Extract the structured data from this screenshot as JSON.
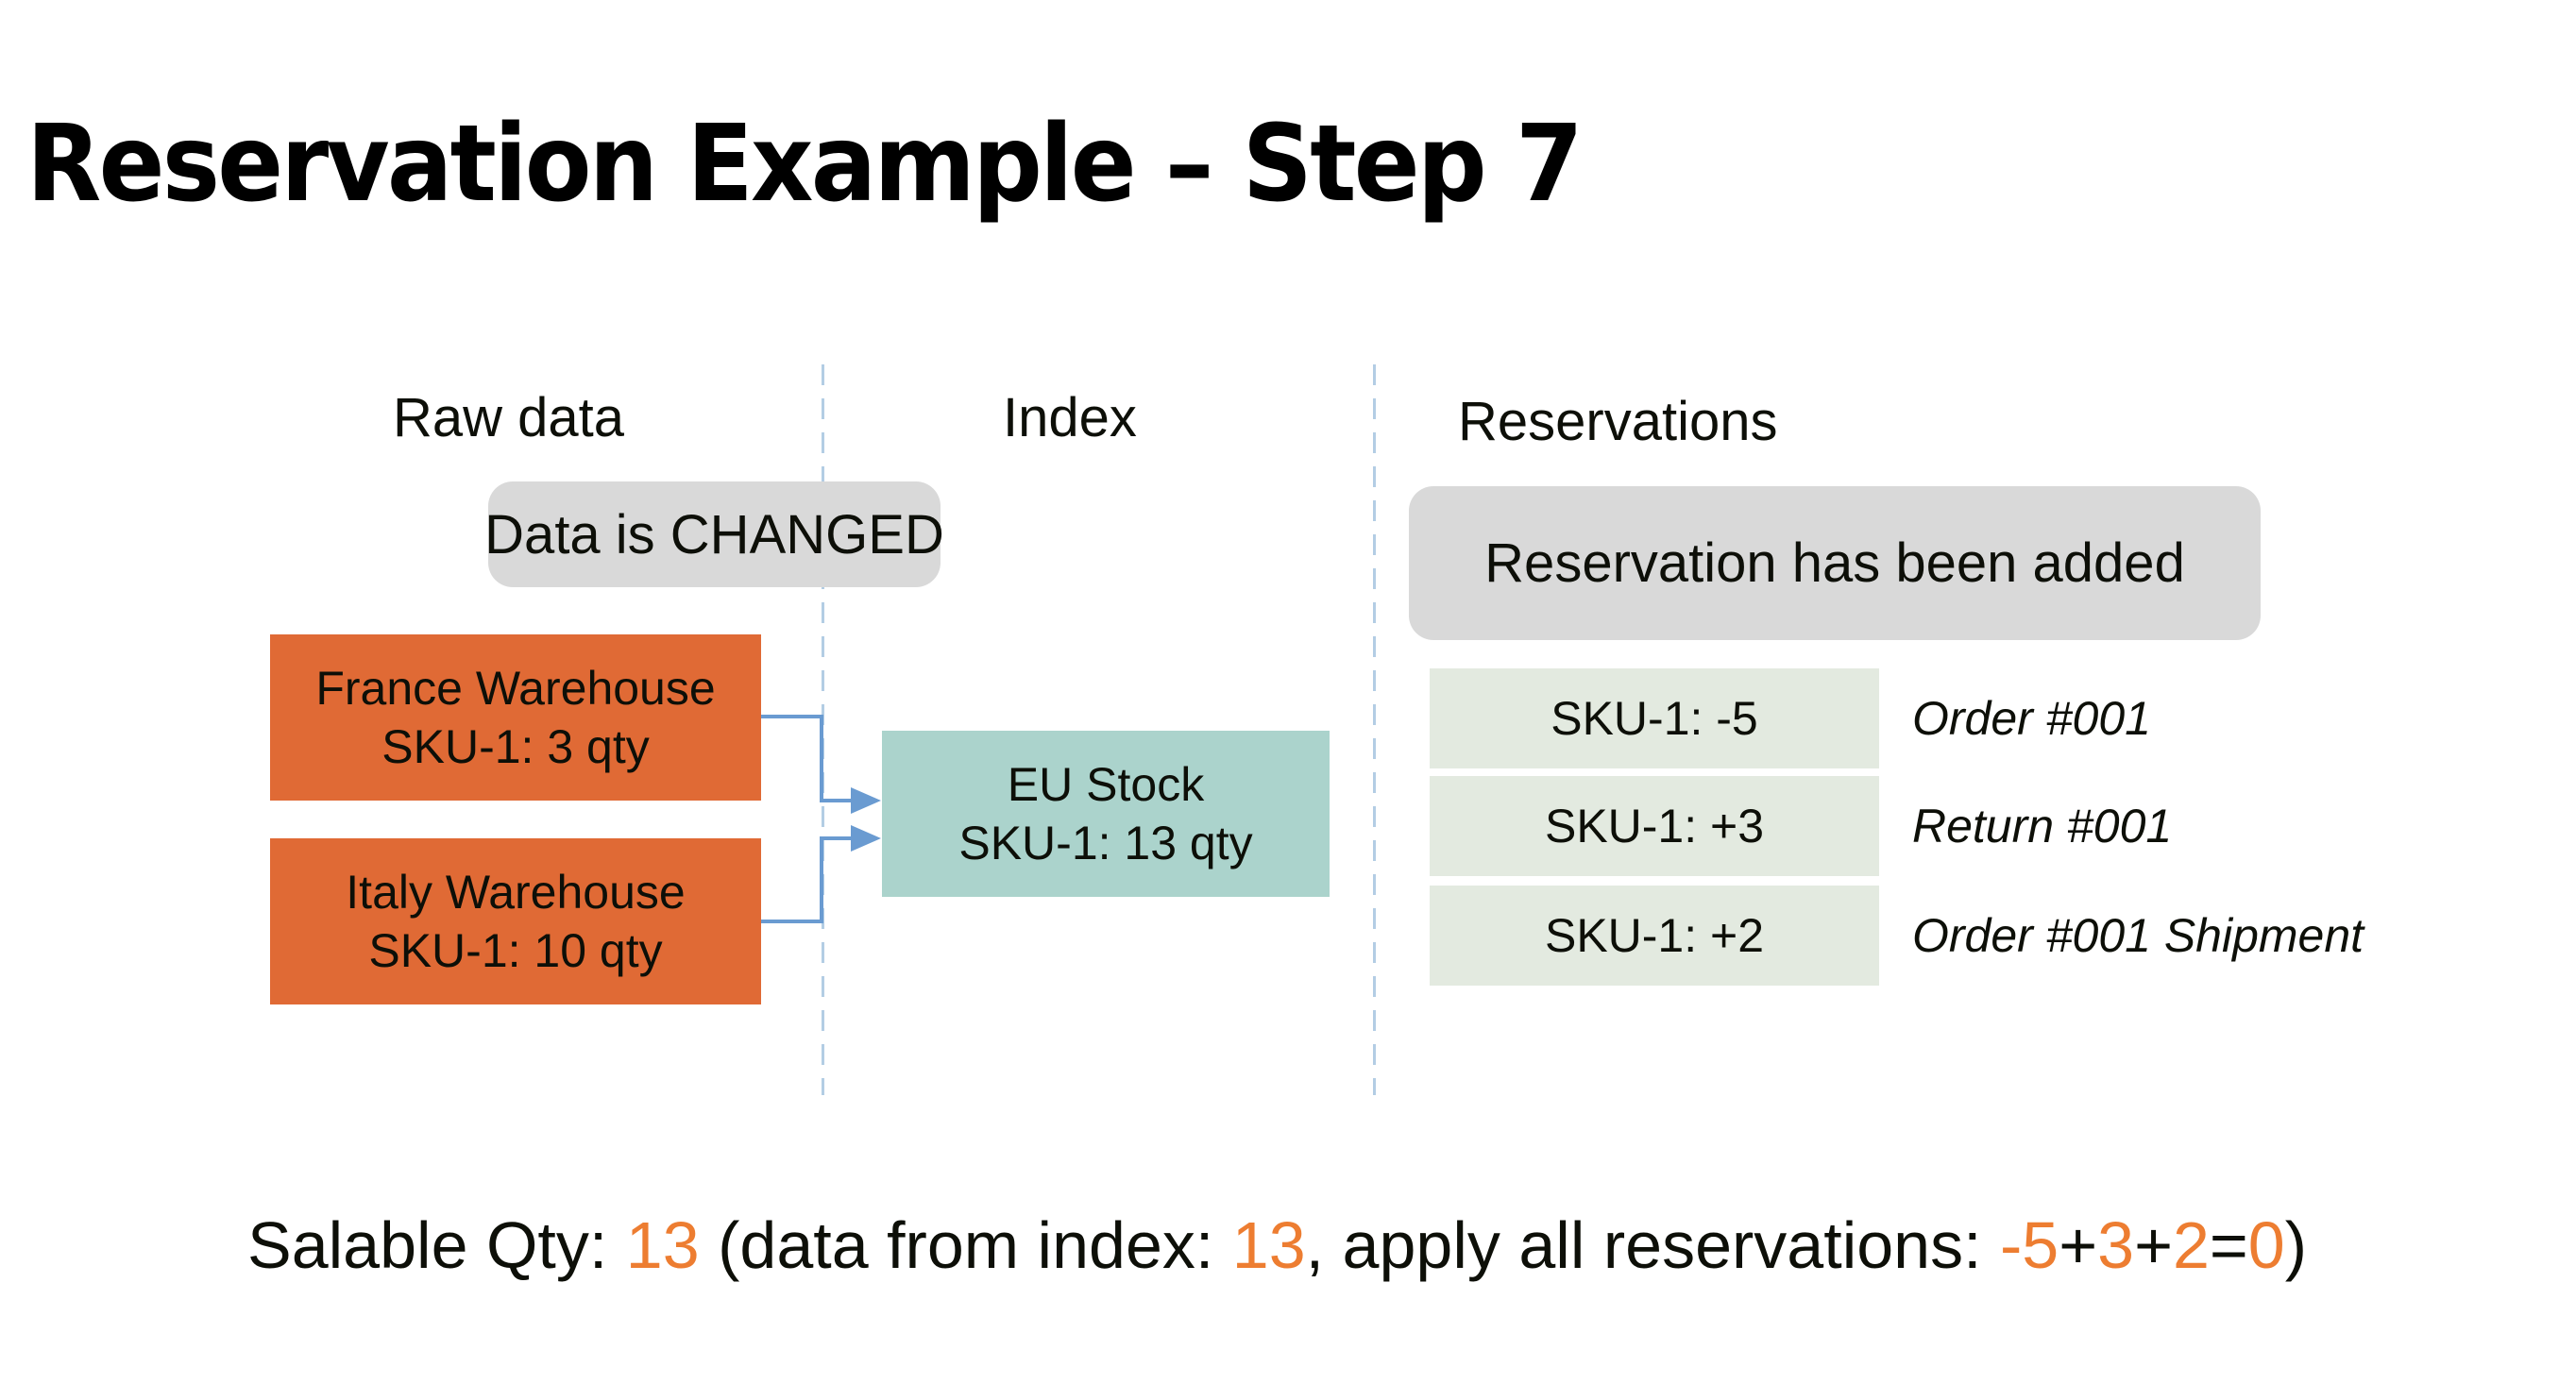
{
  "title": "Reservation Example – Step 7",
  "columns": {
    "raw_data": "Raw data",
    "index": "Index",
    "reservations": "Reservations"
  },
  "callouts": {
    "data_changed": "Data is CHANGED",
    "reservation_added": "Reservation has been added"
  },
  "warehouses": [
    {
      "name": "France Warehouse",
      "stock": "SKU-1: 3 qty"
    },
    {
      "name": "Italy Warehouse",
      "stock": "SKU-1: 10 qty"
    }
  ],
  "index_node": {
    "name": "EU Stock",
    "stock": "SKU-1: 13 qty"
  },
  "reservations": [
    {
      "value": "SKU-1: -5",
      "reason": "Order #001"
    },
    {
      "value": "SKU-1: +3",
      "reason": "Return #001"
    },
    {
      "value": "SKU-1: +2",
      "reason": "Order #001 Shipment"
    }
  ],
  "summary": {
    "label": "Salable Qty: ",
    "salable_qty": "13",
    "text_1": " (data from index: ",
    "index_qty": "13",
    "text_2": ", apply all reservations: ",
    "res_1": "-5",
    "plus_1": "+",
    "res_2": "3",
    "plus_2": "+",
    "res_3": "2",
    "equals": "=",
    "res_total": "0",
    "close": ")"
  },
  "colors": {
    "warehouse": "#e06a35",
    "index": "#abd3cc",
    "reservation_row": "#e3eae0",
    "callout": "#d9d9d9",
    "connector": "#6a9bd1",
    "highlight": "#ed7d31"
  }
}
